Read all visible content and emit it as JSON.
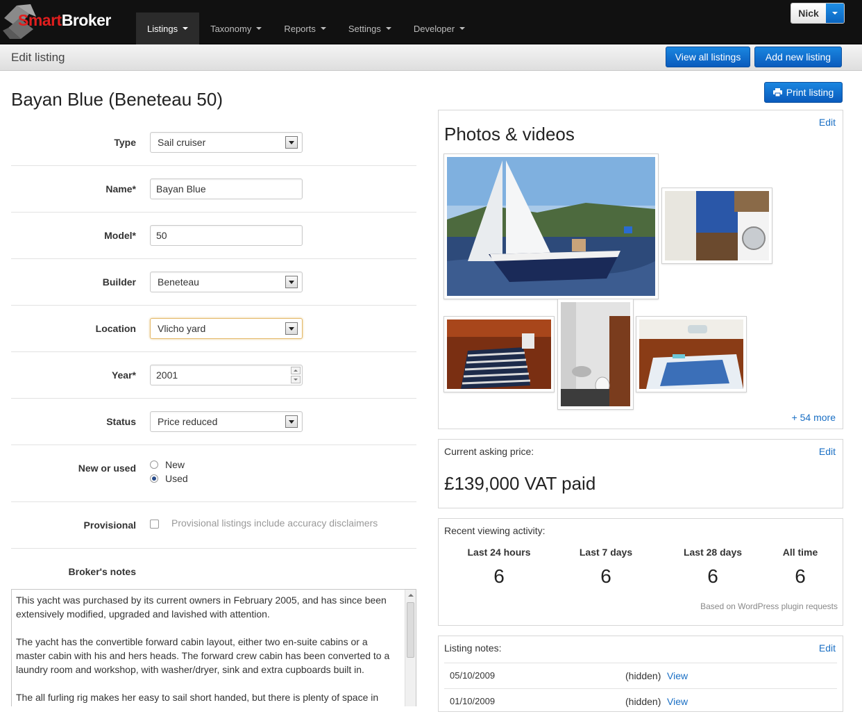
{
  "app": {
    "logo": {
      "smart": "Smart",
      "broker": "Broker"
    },
    "nav": [
      {
        "label": "Listings",
        "active": true
      },
      {
        "label": "Taxonomy"
      },
      {
        "label": "Reports"
      },
      {
        "label": "Settings"
      },
      {
        "label": "Developer"
      }
    ],
    "user": "Nick"
  },
  "subheader": {
    "title": "Edit listing",
    "view_all": "View all listings",
    "add_new": "Add new listing"
  },
  "listing": {
    "title": "Bayan Blue (Beneteau 50)",
    "print_label": "Print listing"
  },
  "form": {
    "type": {
      "label": "Type",
      "value": "Sail cruiser"
    },
    "name": {
      "label": "Name*",
      "value": "Bayan Blue"
    },
    "model": {
      "label": "Model*",
      "value": "50"
    },
    "builder": {
      "label": "Builder",
      "value": "Beneteau"
    },
    "location": {
      "label": "Location",
      "value": "Vlicho yard"
    },
    "year": {
      "label": "Year*",
      "value": "2001"
    },
    "status": {
      "label": "Status",
      "value": "Price reduced"
    },
    "condition": {
      "label": "New or used",
      "options": [
        "New",
        "Used"
      ],
      "selected": "Used"
    },
    "provisional": {
      "label": "Provisional",
      "help": "Provisional listings include accuracy disclaimers",
      "checked": false
    },
    "notes": {
      "label": "Broker's notes",
      "text": "This yacht was purchased by its current owners in February 2005, and has since been extensively modified, upgraded and lavished with attention.\n\n The yacht has the convertible forward cabin layout, either two en-suite cabins or a master cabin with his and hers heads. The forward crew cabin has been converted to a laundry room and workshop, with washer/dryer, sink and extra cupboards built in.\n\n The all furling rig makes her easy to sail short handed, but there is plenty of space in"
    }
  },
  "photos": {
    "title": "Photos & videos",
    "edit": "Edit",
    "more": "+ 54 more"
  },
  "price": {
    "label": "Current asking price:",
    "edit": "Edit",
    "value": "£139,000 VAT paid"
  },
  "activity": {
    "label": "Recent viewing activity:",
    "stats": [
      {
        "label": "Last 24 hours",
        "value": "6"
      },
      {
        "label": "Last 7 days",
        "value": "6"
      },
      {
        "label": "Last 28 days",
        "value": "6"
      },
      {
        "label": "All time",
        "value": "6"
      }
    ],
    "footnote": "Based on WordPress plugin requests"
  },
  "listing_notes": {
    "label": "Listing notes:",
    "edit": "Edit",
    "rows": [
      {
        "date": "05/10/2009",
        "status": "(hidden)",
        "link": "View"
      },
      {
        "date": "01/10/2009",
        "status": "(hidden)",
        "link": "View"
      }
    ]
  }
}
